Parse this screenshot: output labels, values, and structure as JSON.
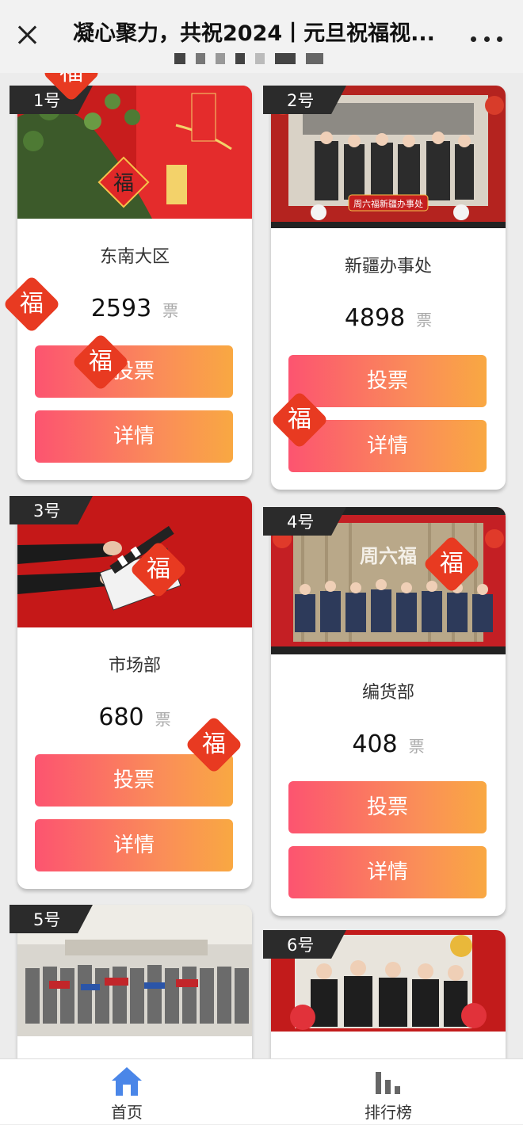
{
  "header": {
    "title": "凝心聚力，共祝2024丨元旦祝福视..."
  },
  "vote_unit": "票",
  "vote_label": "投票",
  "detail_label": "详情",
  "fu_char": "福",
  "cards": [
    {
      "tag": "1号",
      "name": "东南大区",
      "votes": "2593"
    },
    {
      "tag": "2号",
      "name": "新疆办事处",
      "votes": "4898"
    },
    {
      "tag": "3号",
      "name": "市场部",
      "votes": "680"
    },
    {
      "tag": "4号",
      "name": "编货部",
      "votes": "408"
    },
    {
      "tag": "5号",
      "name": "",
      "votes": ""
    },
    {
      "tag": "6号",
      "name": "",
      "votes": ""
    }
  ],
  "photo_text": {
    "card2_banner": "周六福新疆办事处",
    "card4_sign": "周六福"
  },
  "tabbar": {
    "home_label": "首页",
    "ranking_label": "排行榜"
  },
  "colors": {
    "button_start": "#fc5470",
    "button_end": "#f9a842",
    "tag_bg": "#2b2b2b",
    "fu_red": "#e83a21",
    "home_icon": "#4a86e8"
  }
}
